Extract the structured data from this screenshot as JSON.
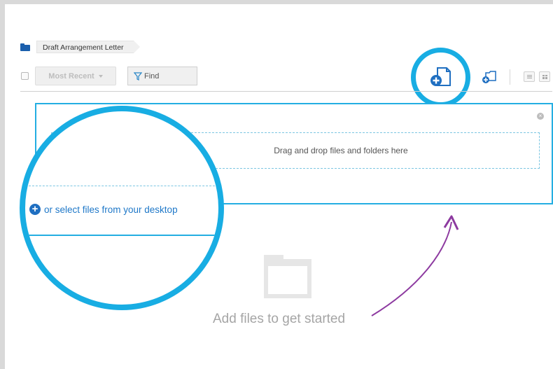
{
  "breadcrumb": {
    "label": "Draft Arrangement Letter"
  },
  "toolbar": {
    "sort_label": "Most Recent",
    "find_label": "Find"
  },
  "upload_panel": {
    "dropzone_text": "Drag and drop files and folders here",
    "select_text": "or select files from your desktop"
  },
  "empty_state": {
    "message": "Add files to get started"
  },
  "icons": {
    "breadcrumb": "folder-icon",
    "find": "filter-icon",
    "upload": "add-file-icon",
    "new_folder": "add-folder-icon",
    "close": "close-icon",
    "select": "plus-circle-icon",
    "empty": "empty-folder-icon"
  },
  "colors": {
    "accent": "#18ade3",
    "link": "#1f78c8",
    "folder_blue": "#1b5fad",
    "arrow": "#8d3aa0"
  }
}
